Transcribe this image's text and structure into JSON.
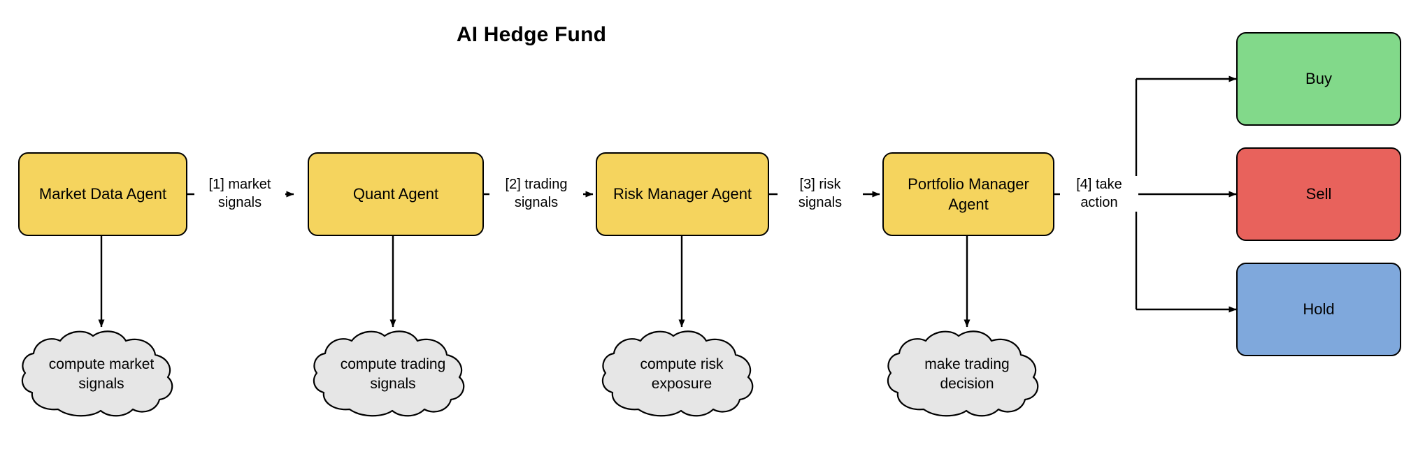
{
  "diagram": {
    "title": "AI Hedge Fund",
    "background_color": "#ffffff"
  },
  "colors": {
    "agent_fill": "#F5D45E",
    "buy_fill": "#82D98A",
    "sell_fill": "#E8625C",
    "hold_fill": "#7FA8DC",
    "cloud_fill": "#E6E6E6",
    "stroke": "#000000"
  },
  "agents": [
    {
      "id": "market-data-agent",
      "label": "Market Data\nAgent"
    },
    {
      "id": "quant-agent",
      "label": "Quant\nAgent"
    },
    {
      "id": "risk-manager-agent",
      "label": "Risk Manager\nAgent"
    },
    {
      "id": "portfolio-manager-agent",
      "label": "Portfolio Manager\nAgent"
    }
  ],
  "edge_labels": [
    {
      "id": "edge-1",
      "label": "[1] market\nsignals"
    },
    {
      "id": "edge-2",
      "label": "[2] trading\nsignals"
    },
    {
      "id": "edge-3",
      "label": "[3] risk\nsignals"
    },
    {
      "id": "edge-4",
      "label": "[4] take\naction"
    }
  ],
  "decisions": [
    {
      "id": "decision-buy",
      "label": "Buy",
      "color": "#82D98A"
    },
    {
      "id": "decision-sell",
      "label": "Sell",
      "color": "#E8625C"
    },
    {
      "id": "decision-hold",
      "label": "Hold",
      "color": "#7FA8DC"
    }
  ],
  "computations": [
    {
      "id": "cloud-compute-market-signals",
      "label": "compute market\nsignals"
    },
    {
      "id": "cloud-compute-trading-signals",
      "label": "compute trading\nsignals"
    },
    {
      "id": "cloud-compute-risk-exposure",
      "label": "compute risk\nexposure"
    },
    {
      "id": "cloud-make-trading-decision",
      "label": "make trading\ndecision"
    }
  ]
}
